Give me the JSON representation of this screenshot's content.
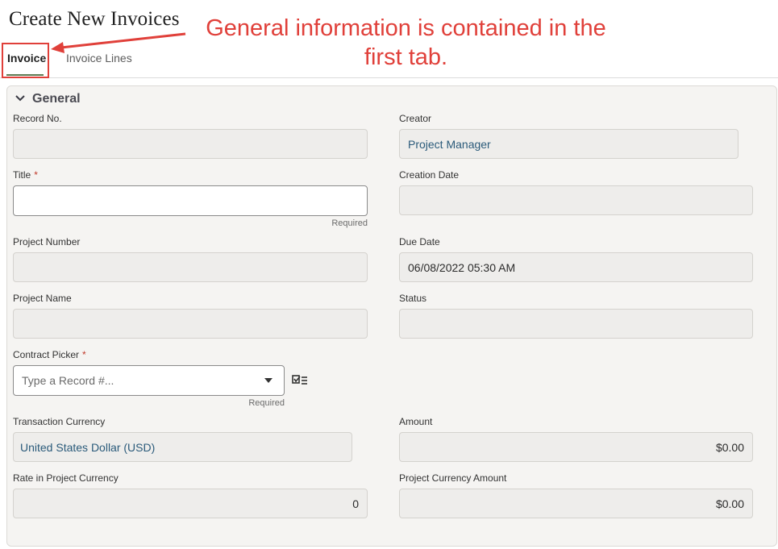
{
  "page": {
    "title": "Create New Invoices"
  },
  "tabs": [
    {
      "label": "Invoice",
      "active": true
    },
    {
      "label": "Invoice Lines",
      "active": false
    }
  ],
  "annotation": {
    "text": "General information is contained in the first tab.",
    "color": "#e0403a"
  },
  "section": {
    "title": "General",
    "icon": "chevron-down-icon"
  },
  "fields": {
    "record_no": {
      "label": "Record No.",
      "value": ""
    },
    "creator": {
      "label": "Creator",
      "value": "Project Manager"
    },
    "title": {
      "label": "Title",
      "value": "",
      "hint": "Required",
      "required": true
    },
    "creation_date": {
      "label": "Creation Date",
      "value": ""
    },
    "project_number": {
      "label": "Project Number",
      "value": ""
    },
    "due_date": {
      "label": "Due Date",
      "value": "06/08/2022 05:30 AM"
    },
    "project_name": {
      "label": "Project Name",
      "value": ""
    },
    "status": {
      "label": "Status",
      "value": ""
    },
    "contract_picker": {
      "label": "Contract Picker",
      "placeholder": "Type a Record #...",
      "hint": "Required",
      "required": true,
      "icon": "checklist-picker-icon"
    },
    "transaction_currency": {
      "label": "Transaction Currency",
      "value": "United States Dollar (USD)"
    },
    "amount": {
      "label": "Amount",
      "value": "$0.00"
    },
    "rate_in_project_currency": {
      "label": "Rate in Project Currency",
      "value": "0"
    },
    "project_currency_amount": {
      "label": "Project Currency Amount",
      "value": "$0.00"
    }
  },
  "colors": {
    "accent_tab": "#5e7b52",
    "required": "#c0392b",
    "link_text": "#2a5a7a"
  }
}
